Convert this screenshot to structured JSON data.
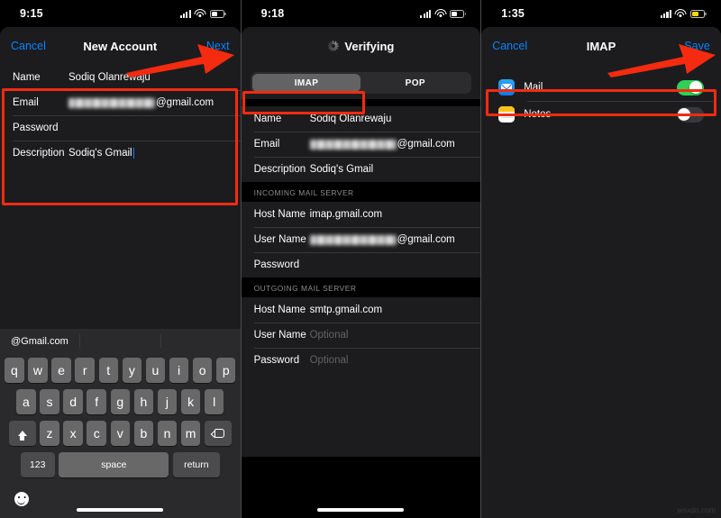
{
  "panels": [
    {
      "status": {
        "time": "9:15",
        "battery_level_pct": 45,
        "battery_color": "#ffffff",
        "wifi": "wifi-icon",
        "signal": "cellular-signal-icon"
      },
      "nav": {
        "left": "Cancel",
        "title": "New Account",
        "right": "Next"
      },
      "form": {
        "rows": [
          {
            "label": "Name",
            "value": "Sodiq Olanrewaju",
            "type": "text"
          },
          {
            "label": "Email",
            "value": "@gmail.com",
            "type": "blurred-email"
          },
          {
            "label": "Password",
            "value": "",
            "type": "text"
          },
          {
            "label": "Description",
            "value": "Sodiq's Gmail",
            "type": "text-caret"
          }
        ]
      },
      "keyboard": {
        "suggestion": "@Gmail.com",
        "row1": [
          "q",
          "w",
          "e",
          "r",
          "t",
          "y",
          "u",
          "i",
          "o",
          "p"
        ],
        "row2": [
          "a",
          "s",
          "d",
          "f",
          "g",
          "h",
          "j",
          "k",
          "l"
        ],
        "row3": [
          "z",
          "x",
          "c",
          "v",
          "b",
          "n",
          "m"
        ],
        "shift_icon": "shift-up-arrow-icon",
        "backspace_icon": "backspace-delete-icon",
        "numbers_key": "123",
        "space_key": "space",
        "return_key": "return",
        "emoji_icon": "emoji-smiley-icon"
      }
    },
    {
      "status": {
        "time": "9:18",
        "battery_level_pct": 45,
        "battery_color": "#ffffff",
        "wifi": "wifi-icon",
        "signal": "cellular-signal-icon"
      },
      "nav": {
        "left": "",
        "title": "Verifying",
        "right": "",
        "spinner": "loading-spinner-icon"
      },
      "segmented": {
        "options": [
          "IMAP",
          "POP"
        ],
        "selected": "IMAP"
      },
      "sections": [
        {
          "header": "",
          "rows": [
            {
              "label": "Name",
              "value": "Sodiq Olanrewaju",
              "type": "text"
            },
            {
              "label": "Email",
              "value": "@gmail.com",
              "type": "blurred-email"
            },
            {
              "label": "Description",
              "value": "Sodiq's Gmail",
              "type": "text"
            }
          ]
        },
        {
          "header": "INCOMING MAIL SERVER",
          "rows": [
            {
              "label": "Host Name",
              "value": "imap.gmail.com",
              "type": "text"
            },
            {
              "label": "User Name",
              "value": "@gmail.com",
              "type": "blurred-email"
            },
            {
              "label": "Password",
              "value": "",
              "type": "text"
            }
          ]
        },
        {
          "header": "OUTGOING MAIL SERVER",
          "rows": [
            {
              "label": "Host Name",
              "value": "smtp.gmail.com",
              "type": "text"
            },
            {
              "label": "User Name",
              "value": "Optional",
              "type": "placeholder"
            },
            {
              "label": "Password",
              "value": "Optional",
              "type": "placeholder"
            }
          ]
        }
      ]
    },
    {
      "status": {
        "time": "1:35",
        "battery_level_pct": 48,
        "battery_color": "#ffd60a",
        "wifi": "wifi-icon",
        "signal": "cellular-signal-icon"
      },
      "nav": {
        "left": "Cancel",
        "title": "IMAP",
        "right": "Save"
      },
      "toggles": [
        {
          "icon": "mail-app-icon",
          "label": "Mail",
          "state": "on"
        },
        {
          "icon": "notes-app-icon",
          "label": "Notes",
          "state": "off"
        }
      ]
    }
  ],
  "annotations": {
    "highlight_color": "#f42b10",
    "boxes": [
      "new-account-form-fields",
      "imap-segment-tab",
      "mail-toggle-row"
    ],
    "arrows": [
      "arrow-to-next-button",
      "arrow-to-save-button"
    ]
  },
  "watermark": "wsxdn.com"
}
